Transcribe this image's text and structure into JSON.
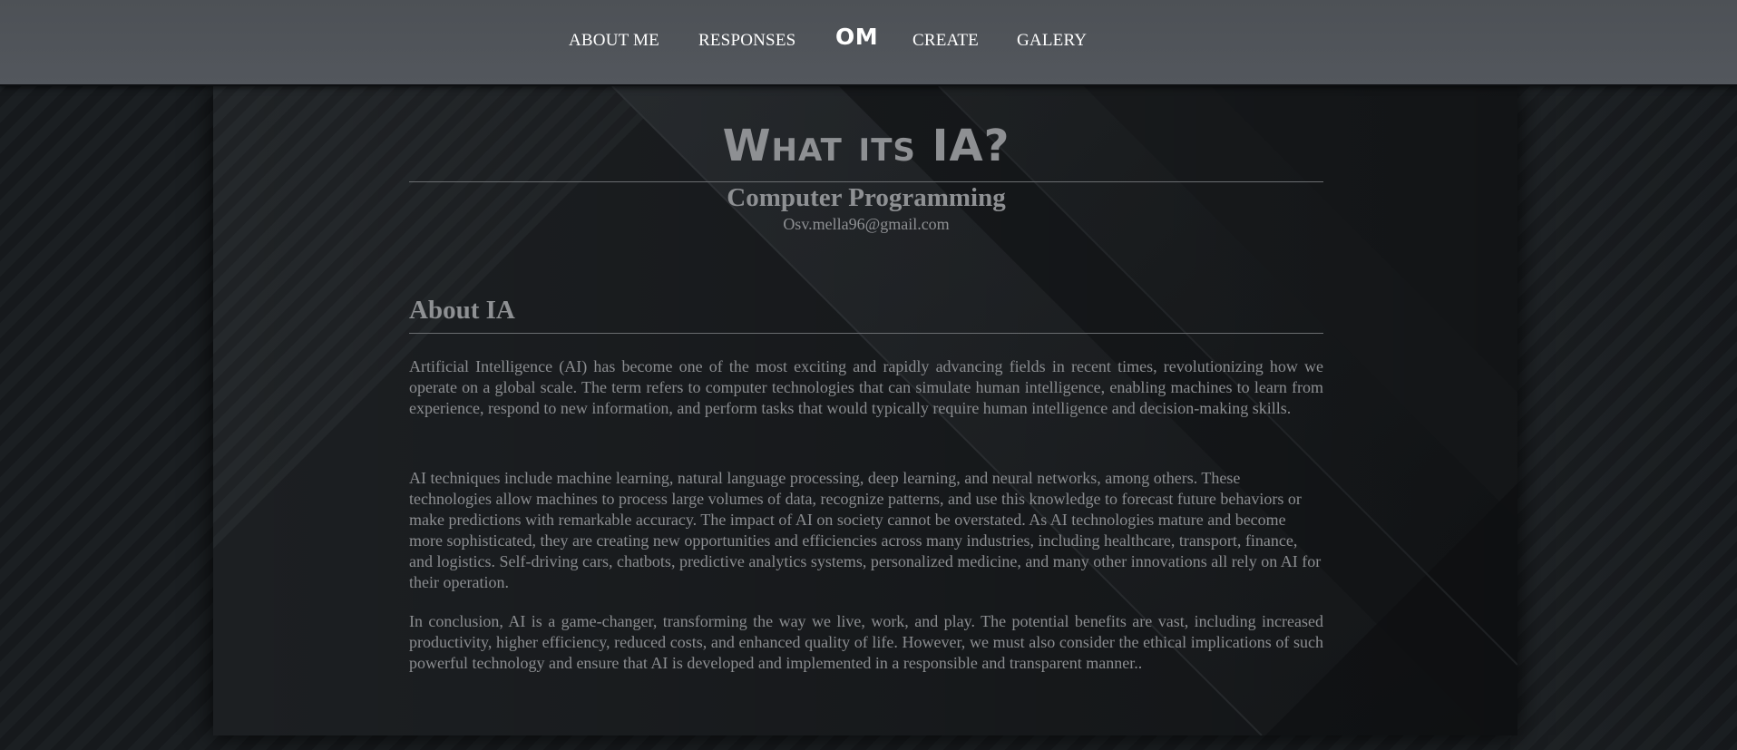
{
  "nav": {
    "items": [
      {
        "label": "ABOUT ME"
      },
      {
        "label": "RESPONSES"
      },
      {
        "label": "CREATE"
      },
      {
        "label": "GALERY"
      }
    ],
    "logo": "OM"
  },
  "header": {
    "title": "What its IA?",
    "subtitle": "Computer Programming",
    "email": "Osv.mella96@gmail.com"
  },
  "section": {
    "heading": "About IA",
    "paragraphs": [
      "Artificial Intelligence (AI) has become one of the most exciting and rapidly advancing fields in recent times, revolutionizing how we operate on a global scale. The term refers to computer technologies that can simulate human intelligence, enabling machines to learn from experience, respond to new information, and perform tasks that would typically require human intelligence and decision-making skills.",
      "AI techniques include machine learning, natural language processing, deep learning, and neural networks, among others. These technologies allow machines to process large volumes of data, recognize patterns, and use this knowledge to forecast future behaviors or make predictions with remarkable accuracy. The impact of AI on society cannot be overstated. As AI technologies mature and become more sophisticated, they are creating new opportunities and efficiencies across many industries, including healthcare, transport, finance, and logistics. Self-driving cars, chatbots, predictive analytics systems, personalized medicine, and many other innovations all rely on AI for their operation.",
      "In conclusion, AI is a game-changer, transforming the way we live, work, and play. The potential benefits are vast, including increased productivity, higher efficiency, reduced costs, and enhanced quality of life. However, we must also consider the ethical implications of such powerful technology and ensure that AI is developed and implemented in a responsible and transparent manner.."
    ]
  },
  "colors": {
    "navbar": "#4f5358",
    "nav_text": "#ffffff",
    "page_background": "#16191c",
    "card_background": "#1c1f22",
    "text": "#8b8d90"
  }
}
